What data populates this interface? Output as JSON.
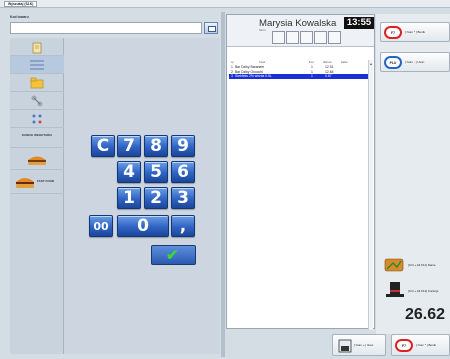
{
  "window_tab": "Wyszukaj (SLK)",
  "search": {
    "label": "Kod towaru",
    "value": ""
  },
  "categories": [
    {
      "label": "",
      "icon": "document-icon"
    },
    {
      "label": "",
      "icon": "list-icon"
    },
    {
      "label": "",
      "icon": "folder-icon"
    },
    {
      "label": "",
      "icon": "network-icon"
    },
    {
      "label": "",
      "icon": "small-items-icon"
    },
    {
      "label": "DANICE WEGETARIA",
      "icon": ""
    },
    {
      "label": "",
      "icon": "burger-icon"
    },
    {
      "label": "FAST FOOD",
      "icon": "fastfood-icon"
    }
  ],
  "numpad": {
    "row1": [
      "C",
      "7",
      "8",
      "9"
    ],
    "row2": [
      "4",
      "5",
      "6"
    ],
    "row3": [
      "1",
      "2",
      "3"
    ],
    "row4": [
      "00",
      "0",
      ","
    ]
  },
  "receipt": {
    "cashier": "Marysia Kowalska",
    "time": "13:55",
    "small_label": "Stol 1",
    "columns": [
      "Lp",
      "Towar",
      "Ilosc",
      "Wartosc",
      "Rabat"
    ],
    "items": [
      {
        "lp": "1",
        "name": "Bar Dziky Baranem",
        "qty": "1",
        "value": "12.91",
        "selected": false
      },
      {
        "lp": "2",
        "name": "Bar Dziky Gnocchi",
        "qty": "1",
        "value": "12.84",
        "selected": false
      },
      {
        "lp": "3",
        "name": "Stekfeks 2% wisnia 0.5L",
        "qty": "1",
        "value": "0.87",
        "selected": true
      }
    ]
  },
  "functions": {
    "btn1": {
      "icon": "F7",
      "label": "[ Num * ] Bonik"
    },
    "btn2": {
      "icon": "PLU",
      "label": "[ Num - ] Usun"
    },
    "btn3": {
      "label": "[Ctrl + Alt F11] Danie"
    },
    "btn4": {
      "label": "[Ctrl + Alt F12] Funkcje"
    }
  },
  "total": "26.62",
  "bottom": {
    "btn1": "[ Num + ] Ilosc",
    "btn2": "[ Num * ] Bonik"
  },
  "colors": {
    "selected_row": "#1a2fd6",
    "key_blue": "#2f63c2",
    "ok_green": "#3cd43c"
  }
}
